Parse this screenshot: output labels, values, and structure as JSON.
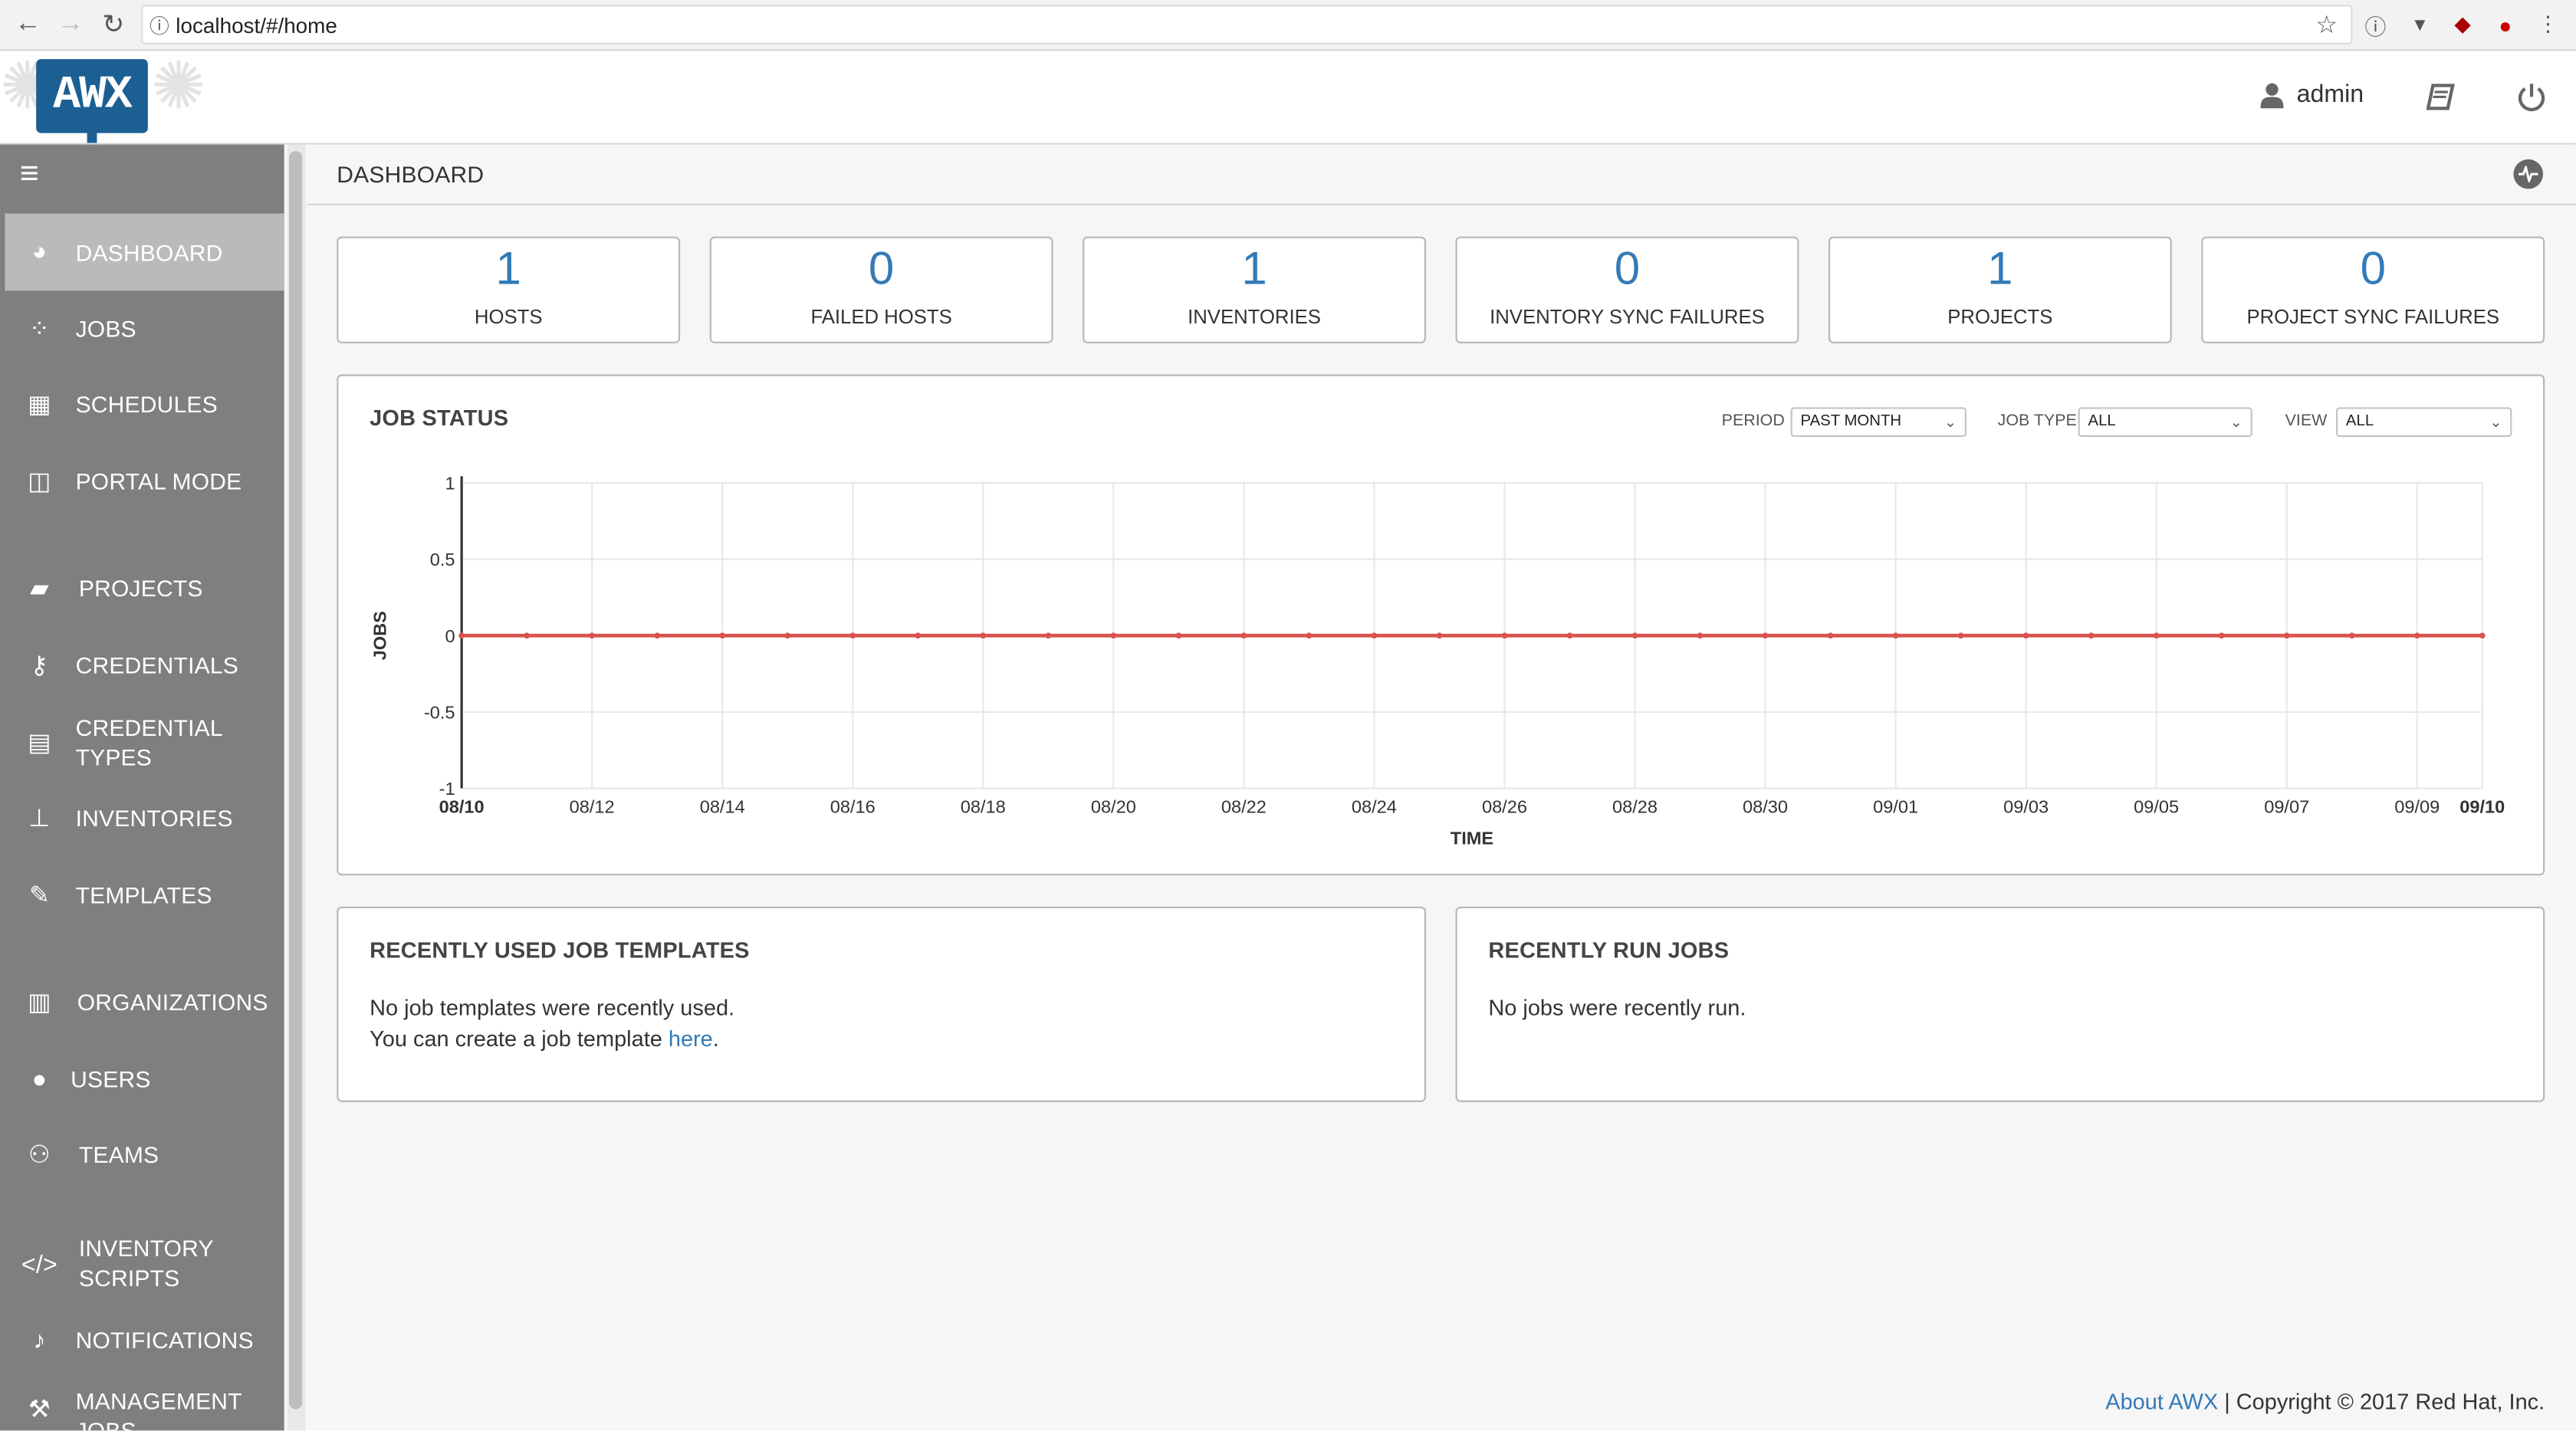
{
  "browser": {
    "url": "localhost/#/home",
    "back_icon": "arrow-left",
    "forward_icon": "arrow-right",
    "reload_icon": "reload",
    "info_icon": "info-circle",
    "star_icon": "star"
  },
  "header": {
    "logo_text": "AWX",
    "user_label": "admin",
    "user_icon": "user-icon",
    "docs_icon": "book-icon",
    "logout_icon": "power-icon"
  },
  "sidebar": {
    "toggle_icon": "hamburger",
    "items": [
      {
        "label": "DASHBOARD",
        "icon": "dashboard"
      },
      {
        "label": "JOBS",
        "icon": "spinner"
      },
      {
        "label": "SCHEDULES",
        "icon": "calendar"
      },
      {
        "label": "PORTAL MODE",
        "icon": "columns"
      },
      {
        "label": "PROJECTS",
        "icon": "folder-open"
      },
      {
        "label": "CREDENTIALS",
        "icon": "key"
      },
      {
        "label": "CREDENTIAL",
        "label2": "TYPES",
        "icon": "list-alt"
      },
      {
        "label": "INVENTORIES",
        "icon": "sitemap"
      },
      {
        "label": "TEMPLATES",
        "icon": "pencil-square"
      },
      {
        "label": "ORGANIZATIONS",
        "icon": "building"
      },
      {
        "label": "USERS",
        "icon": "user"
      },
      {
        "label": "TEAMS",
        "icon": "users"
      },
      {
        "label": "INVENTORY",
        "label2": "SCRIPTS",
        "icon": "code"
      },
      {
        "label": "NOTIFICATIONS",
        "icon": "bell"
      },
      {
        "label": "MANAGEMENT",
        "label2": "JOBS",
        "icon": "wrench"
      }
    ]
  },
  "main": {
    "title": "DASHBOARD",
    "activity_icon": "activity-stream",
    "counts": [
      {
        "value": "1",
        "label": "HOSTS"
      },
      {
        "value": "0",
        "label": "FAILED HOSTS"
      },
      {
        "value": "1",
        "label": "INVENTORIES"
      },
      {
        "value": "0",
        "label": "INVENTORY SYNC FAILURES"
      },
      {
        "value": "1",
        "label": "PROJECTS"
      },
      {
        "value": "0",
        "label": "PROJECT SYNC FAILURES"
      }
    ],
    "job_status": {
      "title": "JOB STATUS",
      "filters": {
        "period_label": "PERIOD",
        "period_value": "PAST MONTH",
        "job_type_label": "JOB TYPE",
        "job_type_value": "ALL",
        "view_label": "VIEW",
        "view_value": "ALL"
      }
    },
    "recent_templates": {
      "title": "RECENTLY USED JOB TEMPLATES",
      "line1": "No job templates were recently used.",
      "line2_prefix": "You can create a job template ",
      "link_text": "here",
      "line2_suffix": "."
    },
    "recent_jobs": {
      "title": "RECENTLY RUN JOBS",
      "line1": "No jobs were recently run."
    }
  },
  "footer": {
    "about_link": "About AWX",
    "copyright": " | Copyright © 2017 Red Hat, Inc."
  },
  "colors": {
    "line": "#d9534f",
    "accent": "#337ab7",
    "sidebar": "#7f7f7f",
    "sidebar_active": "#bababa"
  },
  "chart_data": {
    "type": "line",
    "xlabel": "TIME",
    "ylabel": "JOBS",
    "ylim": [
      -1,
      1
    ],
    "yticks": [
      "1",
      "0.5",
      "0",
      "-0.5",
      "-1"
    ],
    "xticks": [
      "08/10",
      "08/12",
      "08/14",
      "08/16",
      "08/18",
      "08/20",
      "08/22",
      "08/24",
      "08/26",
      "08/28",
      "08/30",
      "09/01",
      "09/03",
      "09/05",
      "09/07",
      "09/09",
      "09/10"
    ],
    "x": [
      "08/10",
      "08/11",
      "08/12",
      "08/13",
      "08/14",
      "08/15",
      "08/16",
      "08/17",
      "08/18",
      "08/19",
      "08/20",
      "08/21",
      "08/22",
      "08/23",
      "08/24",
      "08/25",
      "08/26",
      "08/27",
      "08/28",
      "08/29",
      "08/30",
      "08/31",
      "09/01",
      "09/02",
      "09/03",
      "09/04",
      "09/05",
      "09/06",
      "09/07",
      "09/08",
      "09/09",
      "09/10"
    ],
    "series": [
      {
        "values": [
          0,
          0,
          0,
          0,
          0,
          0,
          0,
          0,
          0,
          0,
          0,
          0,
          0,
          0,
          0,
          0,
          0,
          0,
          0,
          0,
          0,
          0,
          0,
          0,
          0,
          0,
          0,
          0,
          0,
          0,
          0,
          0
        ],
        "color": "#d9534f"
      }
    ],
    "grid": true
  }
}
